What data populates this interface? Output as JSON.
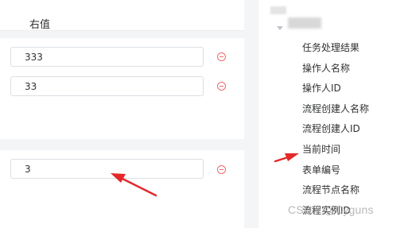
{
  "header": {
    "right_value_label": "右值"
  },
  "conditions": [
    {
      "value": "333"
    },
    {
      "value": "33"
    },
    {
      "value": "3"
    }
  ],
  "dropdown": {
    "items": [
      {
        "label": "任务处理结果"
      },
      {
        "label": "操作人名称"
      },
      {
        "label": "操作人ID"
      },
      {
        "label": "流程创建人名称"
      },
      {
        "label": "流程创建人ID"
      },
      {
        "label": "当前时间"
      },
      {
        "label": "表单编号"
      },
      {
        "label": "流程节点名称"
      },
      {
        "label": "流程实例ID"
      }
    ]
  },
  "watermark": "CSDN @Cyguns",
  "colors": {
    "remove": "#f06a6a",
    "arrow": "#e3292b",
    "border": "#dcdfe6",
    "text": "#303133"
  },
  "icons": {
    "remove": "remove-circle-icon",
    "caret": "caret-down-icon",
    "arrow": "annotation-arrow-icon"
  }
}
